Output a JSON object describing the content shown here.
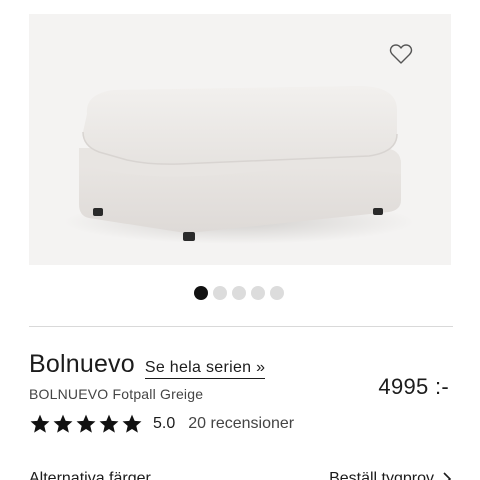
{
  "product": {
    "image_icon": "ottoman-product-image",
    "wishlist_icon": "heart-outline-icon",
    "brand": "Bolnuevo",
    "series_link": "Se hela serien »",
    "subtitle": "BOLNUEVO Fotpall Greige",
    "price": "4995 :-",
    "rating": {
      "stars_filled": 5,
      "stars_total": 5,
      "value": "5.0",
      "reviews": "20 recensioner"
    }
  },
  "carousel": {
    "count": 5,
    "active_index": 0
  },
  "options": {
    "left_label": "Alternativa färger",
    "right_label": "Beställ tygprov",
    "right_icon": "chevron-right-icon"
  },
  "colors": {
    "accent": "#111111",
    "dot_inactive": "#dcdcdc",
    "image_bg": "#f4f3f2"
  }
}
